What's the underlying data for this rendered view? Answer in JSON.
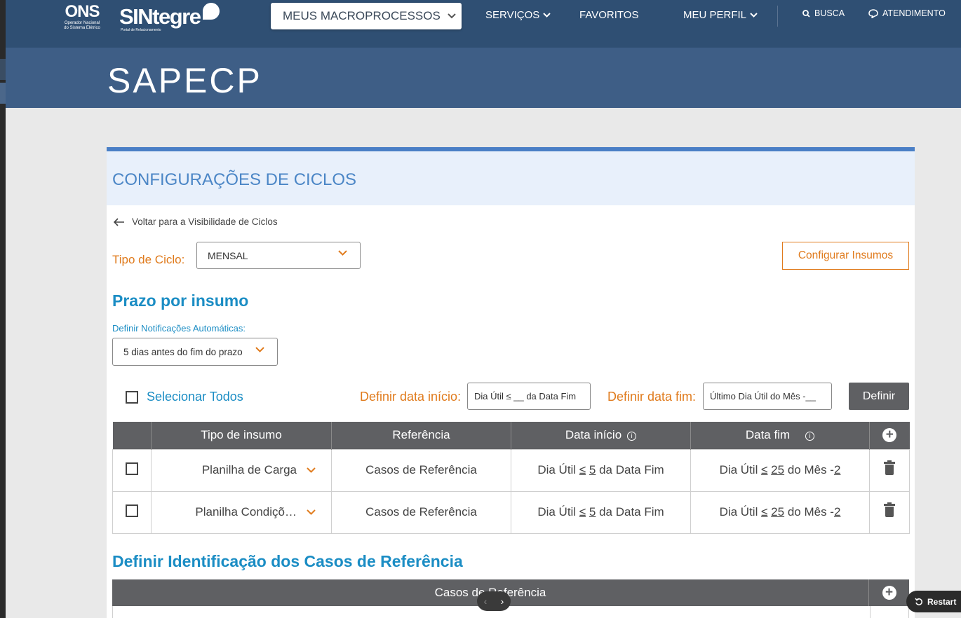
{
  "header": {
    "logo_ons": "ONS",
    "logo_ons_sub1": "Operador Nacional",
    "logo_ons_sub2": "do Sistema Elétrico",
    "logo_sintegre": "SINtegre",
    "logo_sintegre_sub": "Portal de Relacionamento",
    "macroprocessos_label": "MEUS MACROPROCESSOS",
    "nav": {
      "servicos": "SERVIÇOS",
      "favoritos": "FAVORITOS",
      "meu_perfil": "MEU PERFIL",
      "busca": "BUSCA",
      "atendimento": "ATENDIMENTO"
    },
    "icons": {
      "chevron": "chevron-down-icon",
      "search": "search-icon",
      "chat": "chat-icon"
    }
  },
  "banner": {
    "title": "SAPECP"
  },
  "card": {
    "title": "CONFIGURAÇÕES DE CICLOS",
    "back_label": "Voltar para a Visibilidade de Ciclos",
    "tipo_ciclo_label": "Tipo de Ciclo:",
    "tipo_ciclo_value": "MENSAL",
    "configurar_insumos": "Configurar Insumos",
    "prazo_title": "Prazo por insumo",
    "notificacoes_label": "Definir Notificações Automáticas:",
    "notificacoes_value": "5 dias antes do fim do prazo",
    "selecionar_todos": "Selecionar Todos",
    "definir_inicio_label": "Definir data início:",
    "definir_inicio_value": "Dia Útil ≤ __ da Data Fim",
    "definir_fim_label": "Definir data fim:",
    "definir_fim_value": "Último Dia Útil do Mês -__",
    "definir_button": "Definir",
    "table": {
      "headers": [
        "Tipo de insumo",
        "Referência",
        "Data início",
        "Data fim"
      ],
      "rows": [
        {
          "tipo": "Planilha de Carga",
          "referencia": "Casos de Referência",
          "inicio_pre": "Dia Útil ",
          "inicio_op": "≤",
          "inicio_num": "5",
          "inicio_post": " da Data Fim",
          "fim_pre": "Dia Útil ",
          "fim_op": "≤",
          "fim_num": "25",
          "fim_mid": " do Mês -",
          "fim_num2": "2"
        },
        {
          "tipo": "Planilha Condiçõ…",
          "referencia": "Casos de Referência",
          "inicio_pre": "Dia Útil ",
          "inicio_op": "≤",
          "inicio_num": "5",
          "inicio_post": " da Data Fim",
          "fim_pre": "Dia Útil ",
          "fim_op": "≤",
          "fim_num": "25",
          "fim_mid": " do Mês -",
          "fim_num2": "2"
        }
      ]
    },
    "identificacao_title": "Definir Identificação dos Casos de Referência",
    "casos_header": "Casos de Referência"
  },
  "overlay": {
    "restart_label": "Restart"
  },
  "colors": {
    "accent_orange": "#e07b1d",
    "accent_blue": "#1b8dc4",
    "header_dark": "#2f4f73",
    "table_header": "#5f6063"
  }
}
